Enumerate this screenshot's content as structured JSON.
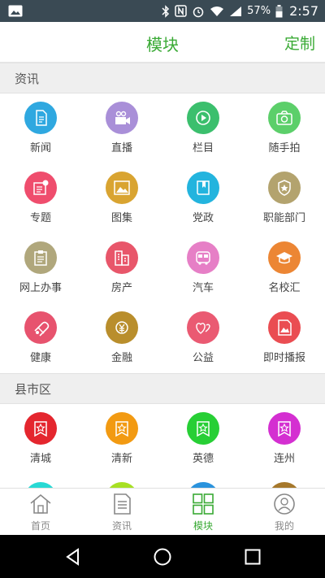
{
  "status": {
    "battery": "57%",
    "time": "2:57"
  },
  "header": {
    "title": "模块",
    "action": "定制"
  },
  "sections": [
    {
      "title": "资讯",
      "items": [
        {
          "label": "新闻",
          "icon": "document-icon",
          "color": "#2fa8e0"
        },
        {
          "label": "直播",
          "icon": "camera-icon",
          "color": "#a98fd8"
        },
        {
          "label": "栏目",
          "icon": "play-icon",
          "color": "#3bbf6d"
        },
        {
          "label": "随手拍",
          "icon": "photo-camera-icon",
          "color": "#5ccf6a"
        },
        {
          "label": "专题",
          "icon": "topic-icon",
          "color": "#ef4d6d"
        },
        {
          "label": "图集",
          "icon": "gallery-icon",
          "color": "#d9a431"
        },
        {
          "label": "党政",
          "icon": "book-icon",
          "color": "#23b4de"
        },
        {
          "label": "职能部门",
          "icon": "badge-icon",
          "color": "#b3a36e"
        },
        {
          "label": "网上办事",
          "icon": "clipboard-icon",
          "color": "#b0a77c"
        },
        {
          "label": "房产",
          "icon": "building-icon",
          "color": "#e8566a"
        },
        {
          "label": "汽车",
          "icon": "bus-icon",
          "color": "#e67fc6"
        },
        {
          "label": "名校汇",
          "icon": "graduation-icon",
          "color": "#ec8634"
        },
        {
          "label": "健康",
          "icon": "pill-icon",
          "color": "#e7536e"
        },
        {
          "label": "金融",
          "icon": "money-icon",
          "color": "#b98e2c"
        },
        {
          "label": "公益",
          "icon": "hearts-icon",
          "color": "#ea5a72"
        },
        {
          "label": "即时播报",
          "icon": "image-icon",
          "color": "#ea4d52"
        }
      ]
    },
    {
      "title": "县市区",
      "items": [
        {
          "label": "清城",
          "icon": "star-flag-icon",
          "color": "#e4262e"
        },
        {
          "label": "清新",
          "icon": "star-flag-icon",
          "color": "#f29a12"
        },
        {
          "label": "英德",
          "icon": "star-flag-icon",
          "color": "#27cf35"
        },
        {
          "label": "连州",
          "icon": "star-flag-icon",
          "color": "#d42fd1"
        },
        {
          "label": "",
          "icon": "star-flag-icon",
          "color": "#28d9d4"
        },
        {
          "label": "",
          "icon": "star-flag-icon",
          "color": "#a7e024"
        },
        {
          "label": "",
          "icon": "star-flag-icon",
          "color": "#2a93dd"
        },
        {
          "label": "",
          "icon": "star-flag-icon",
          "color": "#a6782b"
        }
      ]
    }
  ],
  "tabs": [
    {
      "label": "首页",
      "icon": "home-icon",
      "active": false
    },
    {
      "label": "资讯",
      "icon": "news-icon",
      "active": false
    },
    {
      "label": "模块",
      "icon": "grid-icon",
      "active": true
    },
    {
      "label": "我的",
      "icon": "user-icon",
      "active": false
    }
  ]
}
